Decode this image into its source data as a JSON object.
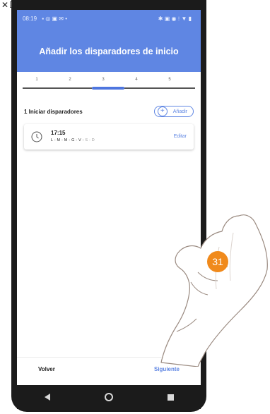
{
  "status": {
    "time": "08:19"
  },
  "header": {
    "title": "Añadir los disparadores de inicio"
  },
  "stepper": {
    "steps": [
      "1",
      "2",
      "3",
      "4",
      "5"
    ],
    "active_step": 3
  },
  "section": {
    "title": "1 Iniciar disparadores",
    "add_label": "Añadir"
  },
  "trigger": {
    "time": "17:15",
    "days_active": "L - M - M - G - V -",
    "days_inactive": " S - D",
    "edit_label": "Editar"
  },
  "footer": {
    "back_label": "Volver",
    "next_label": "Siguiente"
  },
  "badge": {
    "number": "31"
  },
  "colors": {
    "accent": "#5f86e3",
    "badge": "#f08a1c"
  }
}
